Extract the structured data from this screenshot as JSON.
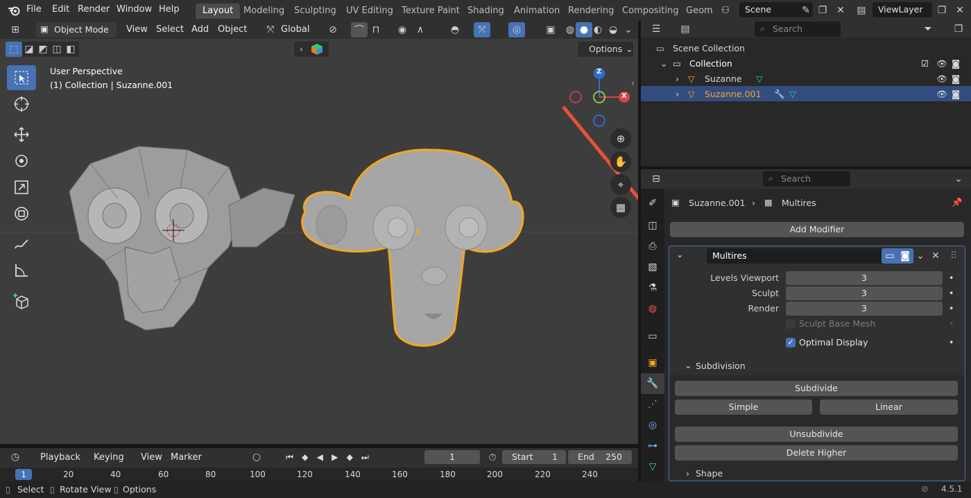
{
  "menu": [
    "File",
    "Edit",
    "Render",
    "Window",
    "Help"
  ],
  "workspaces": [
    "Layout",
    "Modeling",
    "Sculpting",
    "UV Editing",
    "Texture Paint",
    "Shading",
    "Animation",
    "Rendering",
    "Compositing",
    "Geom"
  ],
  "scene": "Scene",
  "view_layer": "ViewLayer",
  "viewport": {
    "mode": "Object Mode",
    "menus": [
      "View",
      "Select",
      "Add",
      "Object"
    ],
    "orientation": "Global",
    "options": "Options",
    "info_line1": "User Perspective",
    "info_line2": "(1) Collection | Suzanne.001",
    "gizmo": {
      "z": "Z",
      "x": "X"
    }
  },
  "outliner": {
    "search_placeholder": "Search",
    "scene_collection": "Scene Collection",
    "collection": "Collection",
    "objects": [
      "Suzanne",
      "Suzanne.001"
    ]
  },
  "properties": {
    "search_placeholder": "Search",
    "breadcrumb_object": "Suzanne.001",
    "breadcrumb_modifier": "Multires",
    "add_modifier": "Add Modifier",
    "modifier_name": "Multires",
    "fields": [
      {
        "label": "Levels Viewport",
        "value": "3"
      },
      {
        "label": "Sculpt",
        "value": "3"
      },
      {
        "label": "Render",
        "value": "3"
      }
    ],
    "sculpt_base_mesh": "Sculpt Base Mesh",
    "optimal_display": "Optimal Display",
    "subdivision_header": "Subdivision",
    "subdivide": "Subdivide",
    "simple": "Simple",
    "linear": "Linear",
    "unsubdivide": "Unsubdivide",
    "delete_higher": "Delete Higher",
    "shape_header": "Shape"
  },
  "timeline": {
    "menus": [
      "Playback",
      "Keying",
      "View",
      "Marker"
    ],
    "current_frame": "1",
    "start_label": "Start",
    "start_value": "1",
    "end_label": "End",
    "end_value": "250",
    "ruler": [
      "1",
      "20",
      "40",
      "60",
      "80",
      "100",
      "120",
      "140",
      "160",
      "180",
      "200",
      "220",
      "240"
    ]
  },
  "status": {
    "select": "Select",
    "rotate_view": "Rotate View",
    "options": "Options",
    "version": "4.5.1"
  },
  "colors": {
    "accent": "#4772b3",
    "selection": "#f5a623",
    "arrow": "#e8503a"
  }
}
